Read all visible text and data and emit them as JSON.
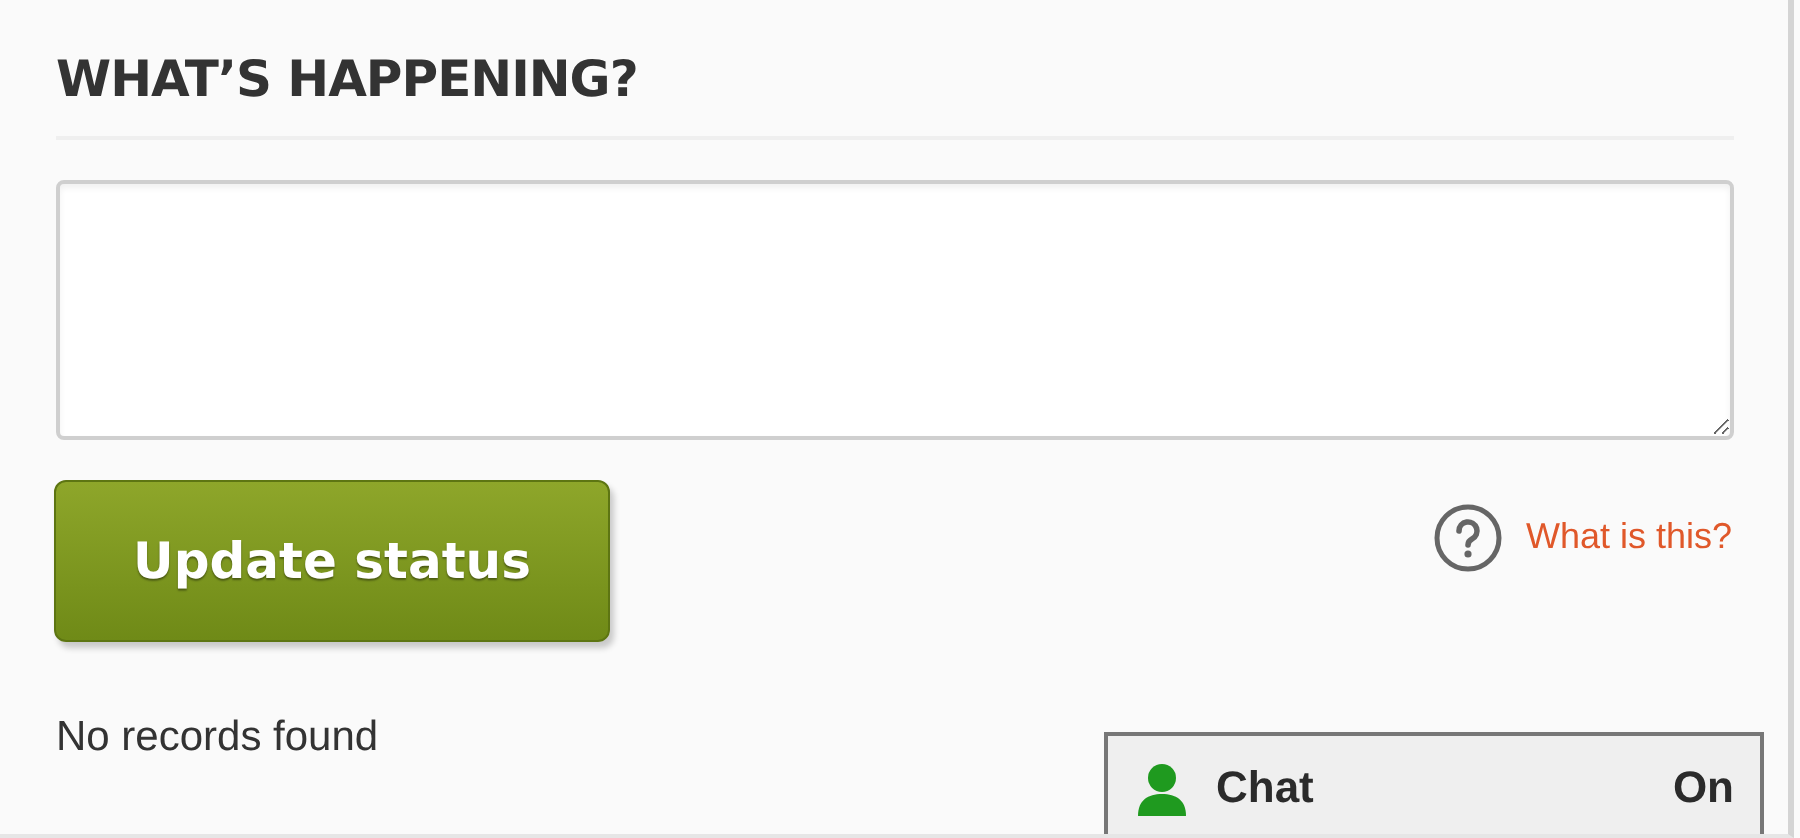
{
  "heading": "WHAT’S HAPPENING?",
  "update_button": "Update status",
  "help_link": "What is this?",
  "empty_message": "No records found",
  "chat_bar": {
    "label": "Chat",
    "status": "On"
  }
}
